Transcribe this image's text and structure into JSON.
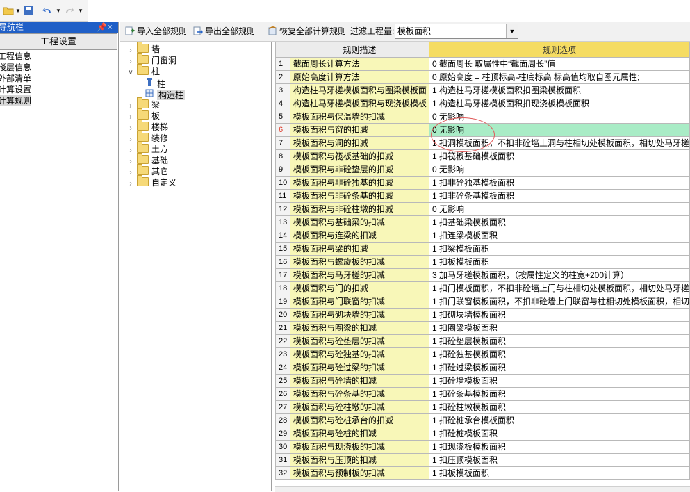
{
  "quick_toolbar": {
    "icons": [
      "folder-open-icon",
      "save-icon",
      "undo-icon",
      "redo-icon"
    ]
  },
  "nav": {
    "title": "导航栏",
    "pin": "ᅲ",
    "close": "×",
    "tab": "工程设置",
    "items": [
      "工程信息",
      "楼层信息",
      "外部清单",
      "计算设置",
      "计算规则"
    ],
    "selected_index": 4
  },
  "toolbar": {
    "import_label": "导入全部规则",
    "export_label": "导出全部规则",
    "restore_label": "恢复全部计算规则",
    "filter_label": "过滤工程量:",
    "filter_value": "模板面积"
  },
  "tree": [
    {
      "label": "墙",
      "state": "collapsed",
      "level": 0
    },
    {
      "label": "门窗洞",
      "state": "collapsed",
      "level": 0
    },
    {
      "label": "柱",
      "state": "expanded",
      "level": 0
    },
    {
      "label": "柱",
      "state": "leaf",
      "level": 1
    },
    {
      "label": "构造柱",
      "state": "leaf",
      "level": 1,
      "selected": true
    },
    {
      "label": "梁",
      "state": "collapsed",
      "level": 0
    },
    {
      "label": "板",
      "state": "collapsed",
      "level": 0
    },
    {
      "label": "楼梯",
      "state": "collapsed",
      "level": 0
    },
    {
      "label": "装修",
      "state": "collapsed",
      "level": 0
    },
    {
      "label": "土方",
      "state": "collapsed",
      "level": 0
    },
    {
      "label": "基础",
      "state": "collapsed",
      "level": 0
    },
    {
      "label": "其它",
      "state": "collapsed",
      "level": 0
    },
    {
      "label": "自定义",
      "state": "collapsed",
      "level": 0
    }
  ],
  "grid": {
    "col_desc": "规则描述",
    "col_option": "规则选项",
    "selected_row": 6,
    "rows": [
      {
        "n": "1",
        "d": "截面周长计算方法",
        "o": "0 截面周长   取属性中“截面周长”值"
      },
      {
        "n": "2",
        "d": "原始高度计算方法",
        "o": "0 原始高度 = 柱顶标高-柱底标高   标高值均取自图元属性;"
      },
      {
        "n": "3",
        "d": "构造柱马牙槎模板面积与圈梁模板面",
        "o": "1  构造柱马牙槎模板面积扣圈梁模板面积"
      },
      {
        "n": "4",
        "d": "构造柱马牙槎模板面积与现浇板模板",
        "o": "1  构造柱马牙槎模板面积扣现浇板模板面积"
      },
      {
        "n": "5",
        "d": "模板面积与保温墙的扣减",
        "o": "0   无影响"
      },
      {
        "n": "6",
        "d": "模板面积与窗的扣减",
        "o": "0   无影响"
      },
      {
        "n": "7",
        "d": "模板面积与洞的扣减",
        "o": "1 扣洞模板面积，不扣非砼墙上洞与柱相切处模板面积，相切处马牙槎"
      },
      {
        "n": "8",
        "d": "模板面积与筏板基础的扣减",
        "o": "1 扣筏板基础模板面积"
      },
      {
        "n": "9",
        "d": "模板面积与非砼垫层的扣减",
        "o": "0   无影响"
      },
      {
        "n": "10",
        "d": "模板面积与非砼独基的扣减",
        "o": "1 扣非砼独基模板面积"
      },
      {
        "n": "11",
        "d": "模板面积与非砼条基的扣减",
        "o": "1 扣非砼条基模板面积"
      },
      {
        "n": "12",
        "d": "模板面积与非砼柱墩的扣减",
        "o": "0   无影响"
      },
      {
        "n": "13",
        "d": "模板面积与基础梁的扣减",
        "o": "1 扣基础梁模板面积"
      },
      {
        "n": "14",
        "d": "模板面积与连梁的扣减",
        "o": "1 扣连梁模板面积"
      },
      {
        "n": "15",
        "d": "模板面积与梁的扣减",
        "o": "1 扣梁模板面积"
      },
      {
        "n": "16",
        "d": "模板面积与螺旋板的扣减",
        "o": "1 扣板模板面积"
      },
      {
        "n": "17",
        "d": "模板面积与马牙槎的扣减",
        "o": "3 加马牙槎模板面积，（按属性定义的柱宽+200计算）"
      },
      {
        "n": "18",
        "d": "模板面积与门的扣减",
        "o": "1 扣门模板面积，不扣非砼墙上门与柱相切处模板面积，相切处马牙槎"
      },
      {
        "n": "19",
        "d": "模板面积与门联窗的扣减",
        "o": "1 扣门联窗模板面积，不扣非砼墙上门联窗与柱相切处模板面积，相切"
      },
      {
        "n": "20",
        "d": "模板面积与砌块墙的扣减",
        "o": "1 扣砌块墙模板面积"
      },
      {
        "n": "21",
        "d": "模板面积与圈梁的扣减",
        "o": "1 扣圈梁模板面积"
      },
      {
        "n": "22",
        "d": "模板面积与砼垫层的扣减",
        "o": "1 扣砼垫层模板面积"
      },
      {
        "n": "23",
        "d": "模板面积与砼独基的扣减",
        "o": "1 扣砼独基模板面积"
      },
      {
        "n": "24",
        "d": "模板面积与砼过梁的扣减",
        "o": "1 扣砼过梁模板面积"
      },
      {
        "n": "25",
        "d": "模板面积与砼墙的扣减",
        "o": "1 扣砼墙模板面积"
      },
      {
        "n": "26",
        "d": "模板面积与砼条基的扣减",
        "o": "1 扣砼条基模板面积"
      },
      {
        "n": "27",
        "d": "模板面积与砼柱墩的扣减",
        "o": "1 扣砼柱墩模板面积"
      },
      {
        "n": "28",
        "d": "模板面积与砼桩承台的扣减",
        "o": "1 扣砼桩承台模板面积"
      },
      {
        "n": "29",
        "d": "模板面积与砼桩的扣减",
        "o": "1 扣砼桩模板面积"
      },
      {
        "n": "30",
        "d": "模板面积与现浇板的扣减",
        "o": "1 扣现浇板模板面积"
      },
      {
        "n": "31",
        "d": "模板面积与压顶的扣减",
        "o": "1 扣压顶模板面积"
      },
      {
        "n": "32",
        "d": "模板面积与预制板的扣减",
        "o": "1 扣板模板面积"
      }
    ]
  }
}
